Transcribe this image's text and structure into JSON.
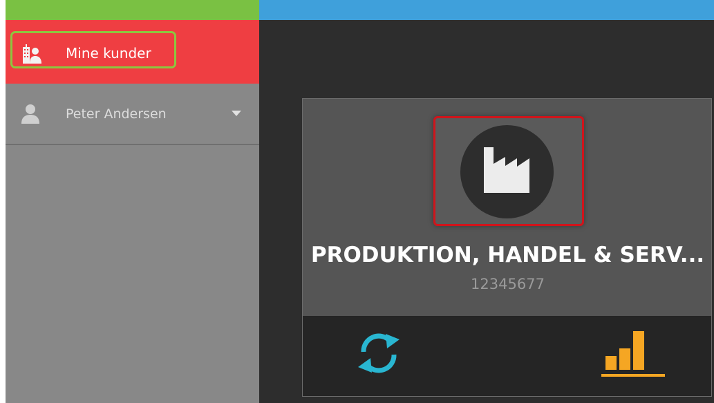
{
  "sidebar": {
    "nav_customers": {
      "label": "Mine kunder",
      "icon": "customers-icon"
    },
    "user": {
      "name": "Peter Andersen",
      "icon": "user-icon",
      "dropdown_icon": "caret-down-icon"
    }
  },
  "customer_card": {
    "company_name": "PRODUKTION, HANDEL & SERV...",
    "company_id": "12345677",
    "logo_icon": "factory-icon",
    "actions": [
      {
        "name": "sync",
        "icon": "sync-icon",
        "color": "#29b6d1"
      },
      {
        "name": "statistics",
        "icon": "bar-chart-icon",
        "color": "#f5a623"
      }
    ]
  },
  "colors": {
    "top_bar_left": "#7ac143",
    "top_bar_right": "#3fa0db",
    "active_nav": "#ef3e42",
    "nav_highlight": "#8dc63f",
    "logo_highlight": "#d0141b",
    "sidebar_bg": "#888888",
    "content_bg": "#2d2d2d"
  }
}
